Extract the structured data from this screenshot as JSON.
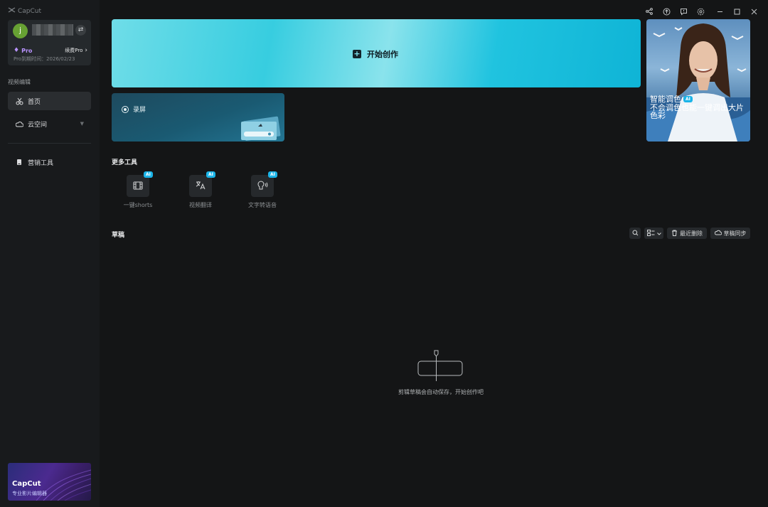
{
  "app": {
    "name": "CapCut"
  },
  "user": {
    "avatar_letter": "j",
    "plan": "Pro",
    "renew_label": "续费Pro",
    "expiry": "Pro到期时间：2026/02/23"
  },
  "sidebar": {
    "section_label": "视频编辑",
    "items": [
      {
        "label": "首页",
        "icon": "scissors-icon",
        "active": true
      },
      {
        "label": "云空间",
        "icon": "cloud-icon",
        "active": false
      },
      {
        "label": "营销工具",
        "icon": "tablet-icon",
        "active": false
      }
    ],
    "promo": {
      "title": "CapCut",
      "subtitle": "专业影片编辑器"
    }
  },
  "hero": {
    "button_label": "开始创作"
  },
  "side_card": {
    "title": "智能调色",
    "badge": "AI",
    "description": "不会调色也能一键调出大片色彩"
  },
  "record_card": {
    "label": "录屏"
  },
  "more_tools": {
    "title": "更多工具",
    "items": [
      {
        "label": "一键shorts",
        "badge": "AI",
        "icon": "film-icon"
      },
      {
        "label": "视频翻译",
        "badge": "AI",
        "icon": "translate-icon"
      },
      {
        "label": "文字转语音",
        "badge": "AI",
        "icon": "speech-icon"
      }
    ]
  },
  "drafts": {
    "title": "草稿",
    "recent_deleted": "最近删除",
    "sync": "草稿同步",
    "empty_message": "剪辑草稿会自动保存，开始创作吧"
  },
  "colors": {
    "accent": "#1ab4e8",
    "hero_start": "#6fdde8",
    "hero_end": "#0fb4d6",
    "pro": "#b993ff",
    "avatar": "#67a133"
  }
}
